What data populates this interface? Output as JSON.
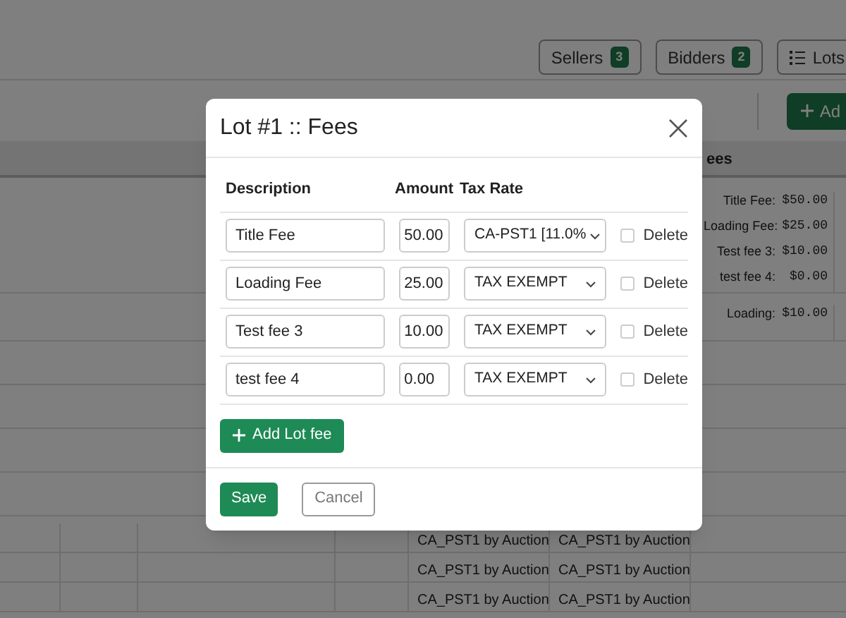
{
  "top_bar": {
    "buttons": [
      {
        "kind": "count",
        "label": "Sellers",
        "count": "3"
      },
      {
        "kind": "count",
        "label": "Bidders",
        "count": "2"
      },
      {
        "kind": "list",
        "label": "Lots"
      }
    ]
  },
  "toolbar": {
    "add_button": "Ad"
  },
  "table": {
    "fees_header": "ees",
    "fee_rows": [
      {
        "fees": [
          {
            "name": "Title Fee:",
            "amount": "$50.00"
          },
          {
            "name": "Loading Fee:",
            "amount": "$25.00"
          },
          {
            "name": "Test fee 3:",
            "amount": "$10.00"
          },
          {
            "name": "test fee 4:",
            "amount": "$0.00"
          }
        ]
      },
      {
        "fees": [
          {
            "name": "Loading:",
            "amount": "$10.00"
          }
        ]
      }
    ],
    "tax_rows": [
      {
        "column_5": "CA_PST1 by Auction",
        "column_6": "CA_PST1 by Auction"
      },
      {
        "column_5": "CA_PST1 by Auction",
        "column_6": "CA_PST1 by Auction"
      },
      {
        "column_5": "CA_PST1 by Auction",
        "column_6": "CA_PST1 by Auction"
      }
    ]
  },
  "modal": {
    "title": "Lot #1 :: Fees",
    "columns": [
      "Description",
      "Amount",
      "Tax Rate"
    ],
    "fees": [
      {
        "description": "Title Fee",
        "amount": "50.00",
        "tax_rate": "CA-PST1 [11.0%",
        "delete_label": "Delete",
        "delete_checked": false
      },
      {
        "description": "Loading Fee",
        "amount": "25.00",
        "tax_rate": "TAX EXEMPT",
        "delete_label": "Delete",
        "delete_checked": false
      },
      {
        "description": "Test fee 3",
        "amount": "10.00",
        "tax_rate": "TAX EXEMPT",
        "delete_label": "Delete",
        "delete_checked": false
      },
      {
        "description": "test fee 4",
        "amount": "0.00",
        "tax_rate": "TAX EXEMPT",
        "delete_label": "Delete",
        "delete_checked": false
      }
    ],
    "add_button": "Add Lot fee",
    "save_button": "Save",
    "cancel_button": "Cancel"
  }
}
